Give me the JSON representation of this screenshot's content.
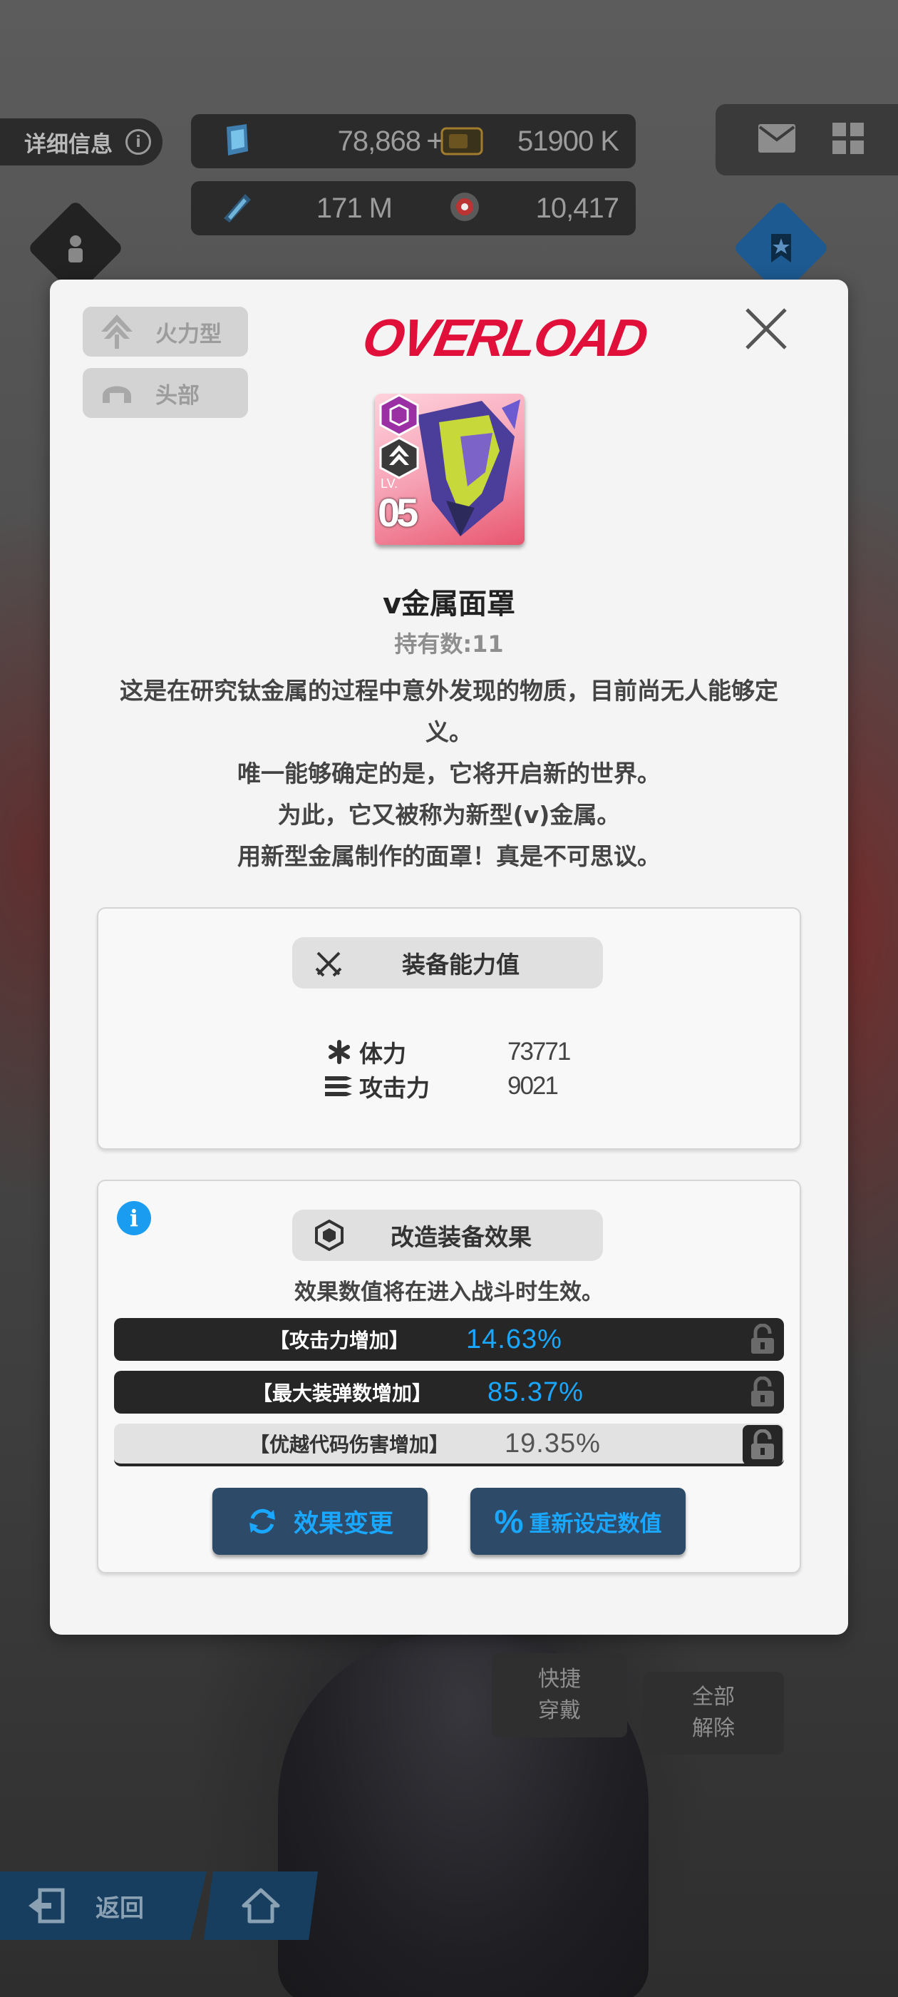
{
  "hud": {
    "detail_label": "详细信息",
    "info_symbol": "i",
    "gems": "78,868",
    "plus": "+",
    "credits": "51900 K",
    "core_dust": "171 M",
    "battle_data": "10,417"
  },
  "bottom": {
    "quick_equip": "快捷\n穿戴",
    "quick_equip_l1": "快捷",
    "quick_equip_l2": "穿戴",
    "remove_all_l1": "全部",
    "remove_all_l2": "解除",
    "back": "返回"
  },
  "modal": {
    "tag_class": "火力型",
    "tag_slot": "头部",
    "brand": "OVERLOAD",
    "card": {
      "lv_label": "LV.",
      "level": "05"
    },
    "item_name": "v金属面罩",
    "owned": "持有数:11",
    "description": [
      "这是在研究钛金属的过程中意外发现的物质，目前尚无人能够定",
      "义。",
      "唯一能够确定的是，它将开启新的世界。",
      "为此，它又被称为新型(v)金属。",
      "用新型金属制作的面罩！真是不可思议。"
    ],
    "equip_stats": {
      "title": "装备能力值",
      "hp_label": "体力",
      "hp_value": "73771",
      "atk_label": "攻击力",
      "atk_value": "9021"
    },
    "effects": {
      "title": "改造装备效果",
      "note": "效果数值将在进入战斗时生效。",
      "rows": [
        {
          "label": "【攻击力增加】",
          "value": "14.63%"
        },
        {
          "label": "【最大装弹数增加】",
          "value": "85.37%"
        },
        {
          "label": "【优越代码伤害增加】",
          "value": "19.35%"
        }
      ],
      "change_btn": "效果变更",
      "reset_btn": "重新设定数值",
      "reset_symbol": "%"
    }
  },
  "colors": {
    "accent_blue": "#1aa7ff",
    "overload_red": "#e0103a",
    "rarity_purple": "#9b2fa4",
    "bar_dark": "#262626",
    "bar_light": "#e2e2e2"
  }
}
